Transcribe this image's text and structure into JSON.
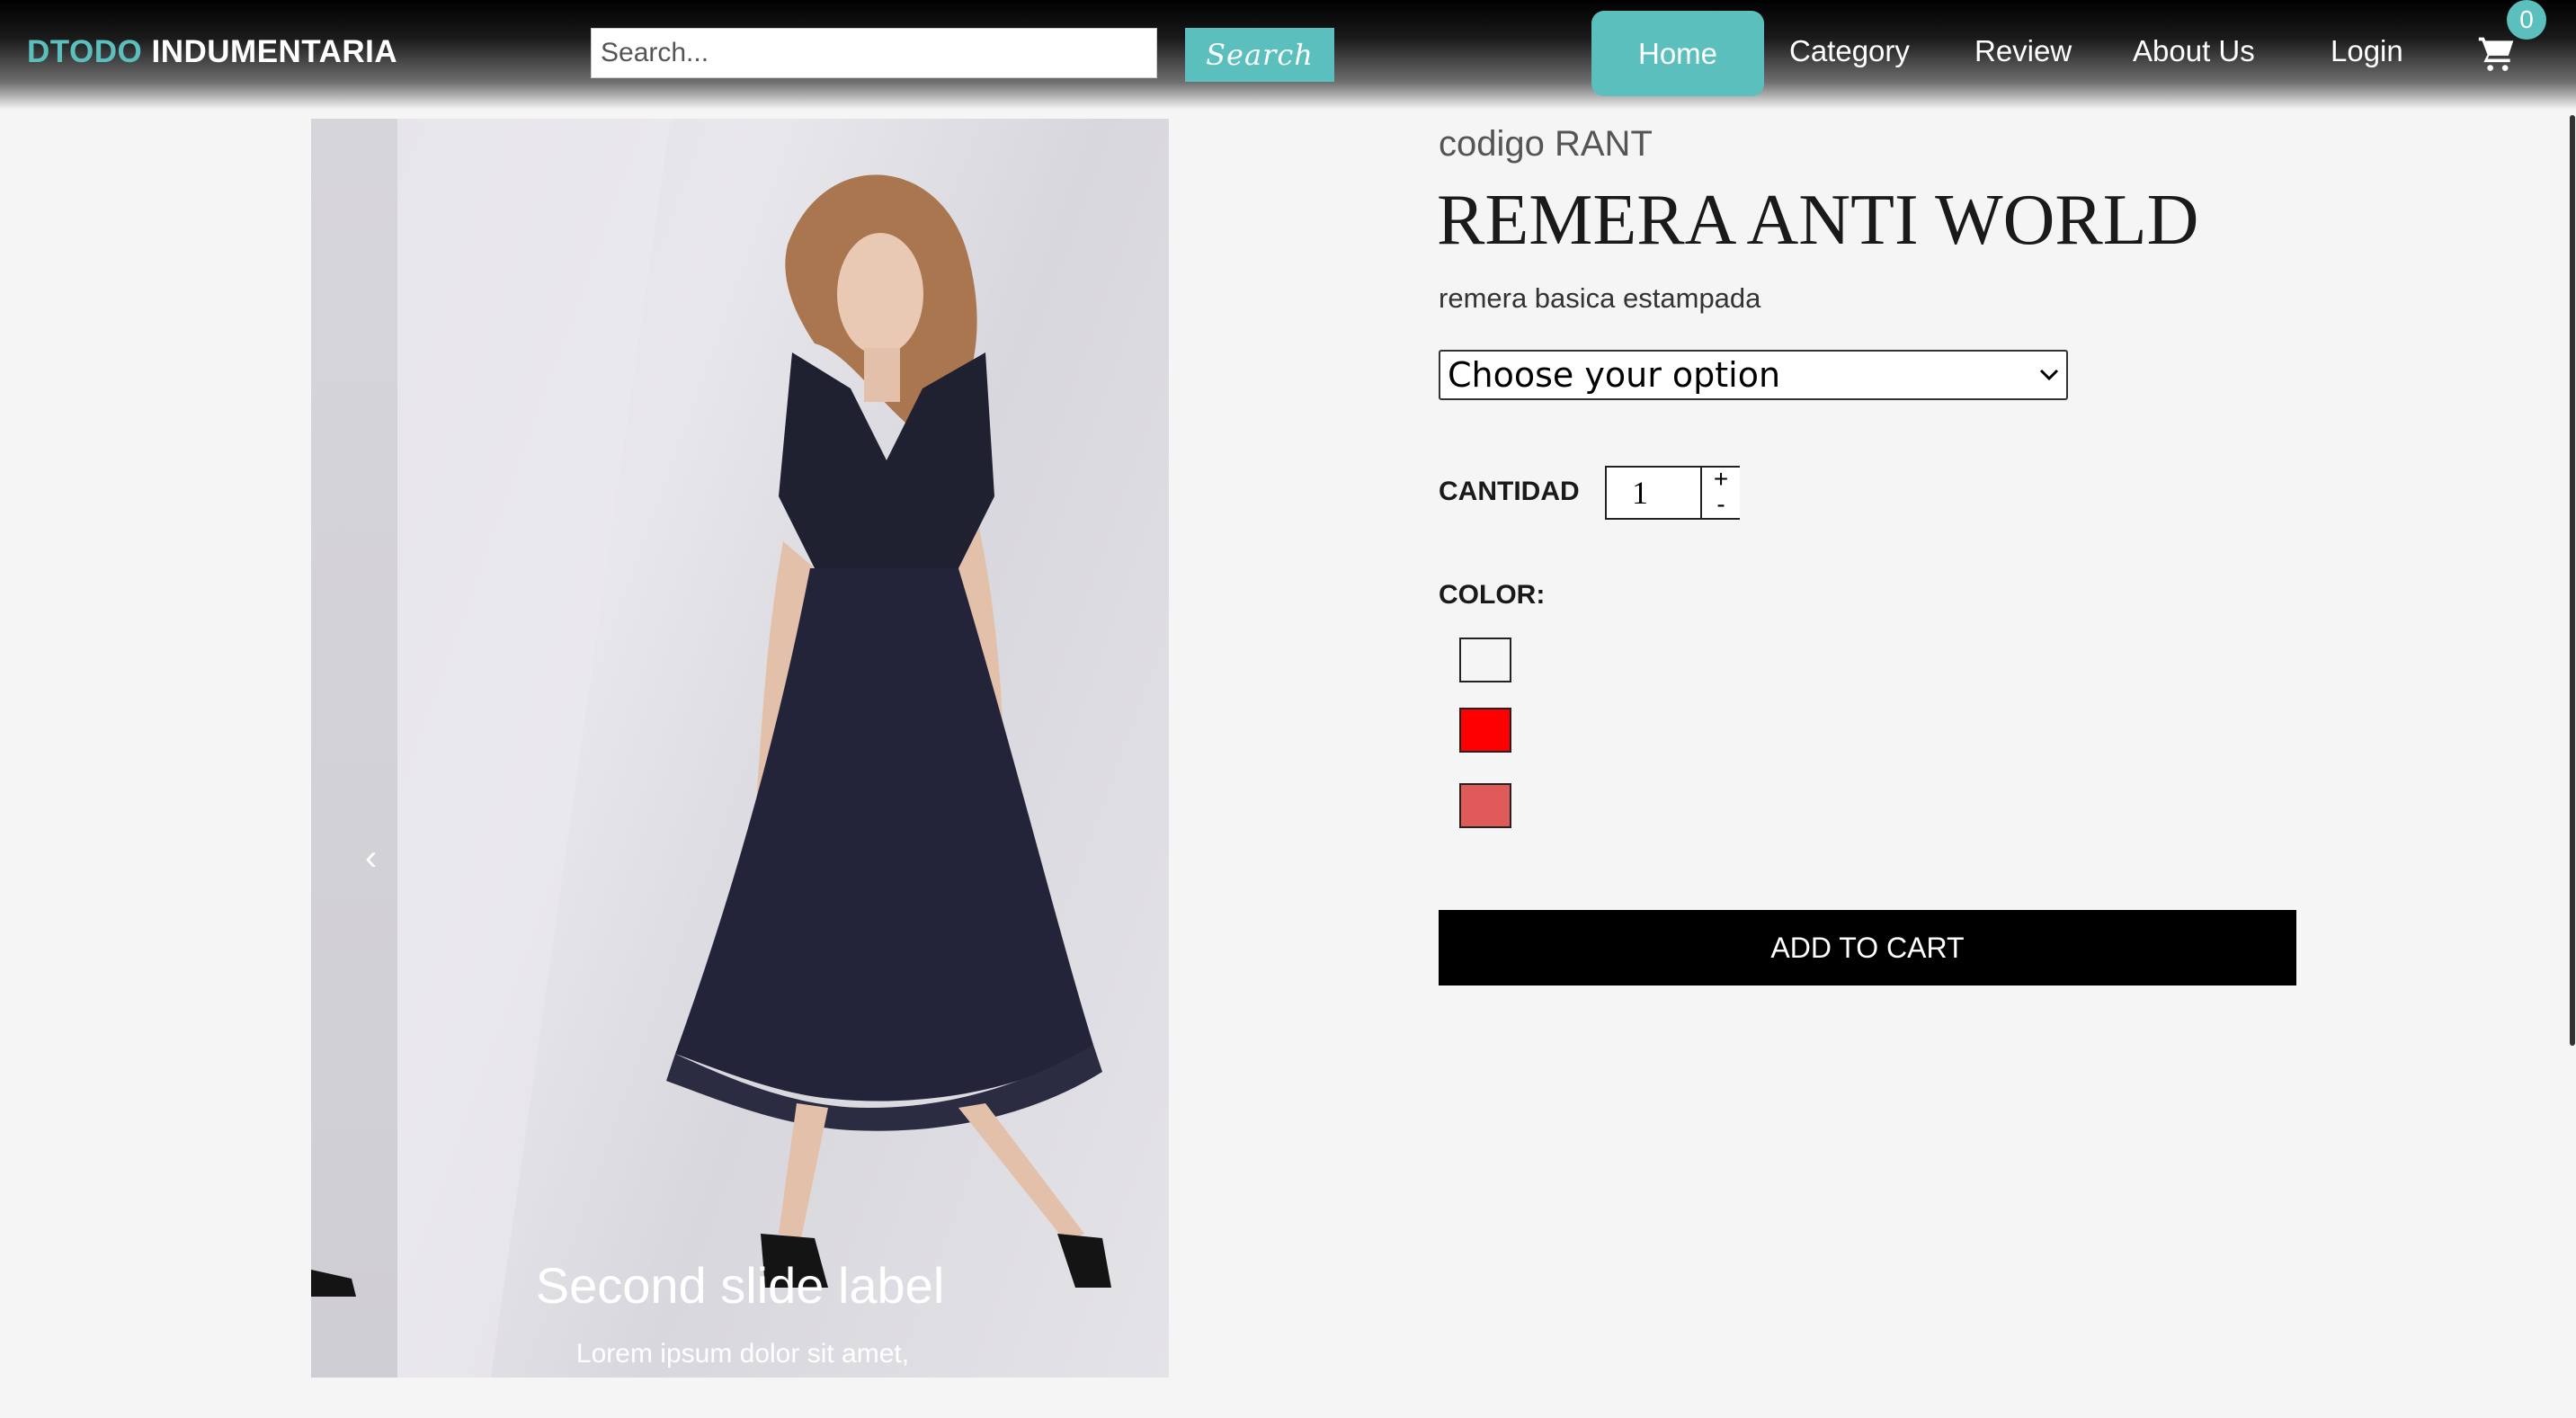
{
  "header": {
    "brand_part1": "DTODO",
    "brand_part2": "INDUMENTARIA",
    "search_placeholder": "Search...",
    "search_button": "Search",
    "nav": [
      "Home",
      "Category",
      "Review",
      "About Us",
      "Login"
    ],
    "cart_count": "0",
    "accent_color": "#5bbfbd"
  },
  "carousel": {
    "caption_title": "Second slide label",
    "caption_text": "Lorem ipsum dolor sit amet, consectetur adipiscing elit.",
    "prev_icon": "‹",
    "indicators": 3,
    "active_index": 1
  },
  "product": {
    "code": "codigo RANT",
    "title": "REMERA ANTI WORLD",
    "description": "remera basica estampada",
    "option_selected": "Choose your option",
    "quantity_label": "CANTIDAD",
    "quantity_value": "1",
    "plus": "+",
    "minus": "-",
    "color_label": "COLOR:",
    "colors": [
      "#f5f5f5",
      "#ff0000",
      "#e05a5a"
    ],
    "add_to_cart": "ADD TO CART"
  }
}
